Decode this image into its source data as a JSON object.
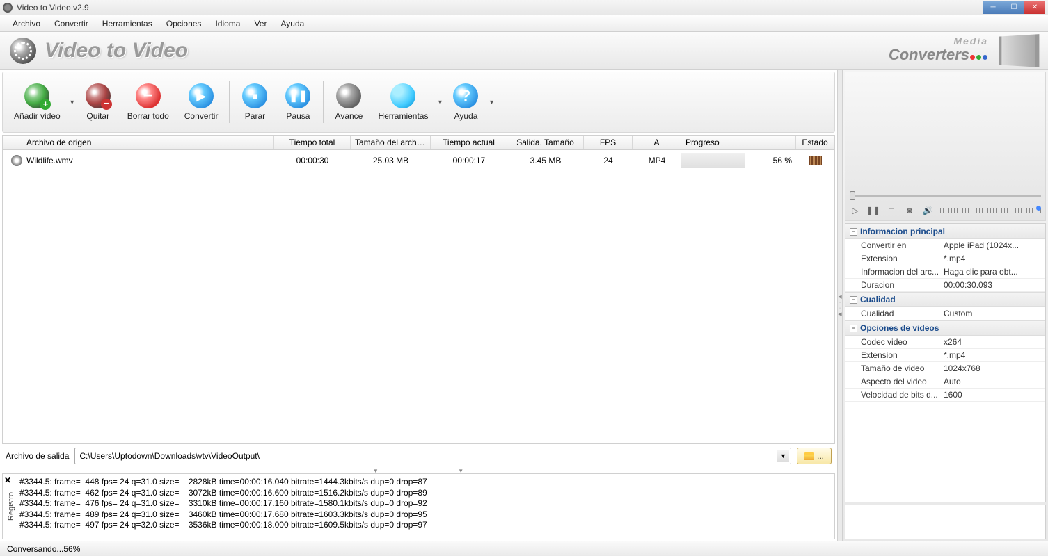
{
  "window": {
    "title": "Video to Video v2.9"
  },
  "menu": {
    "items": [
      "Archivo",
      "Convertir",
      "Herramientas",
      "Opciones",
      "Idioma",
      "Ver",
      "Ayuda"
    ]
  },
  "brand": {
    "text": "Video to Video",
    "right_logo": "Converters",
    "right_logo_sub": "Media"
  },
  "toolbar": {
    "add": "Añadir video",
    "remove": "Quitar",
    "clear": "Borrar todo",
    "convert": "Convertir",
    "stop": "Parar",
    "pause": "Pausa",
    "preview": "Avance",
    "tools": "Herramientas",
    "help": "Ayuda"
  },
  "grid": {
    "headers": {
      "file": "Archivo de origen",
      "total_time": "Tiempo total",
      "file_size": "Tamaño del archivo",
      "current_time": "Tiempo actual",
      "out_size": "Salida. Tamaño",
      "fps": "FPS",
      "a": "A",
      "progress": "Progreso",
      "state": "Estado"
    },
    "rows": [
      {
        "file": "Wildlife.wmv",
        "total_time": "00:00:30",
        "file_size": "25.03 MB",
        "current_time": "00:00:17",
        "out_size": "3.45 MB",
        "fps": "24",
        "a": "MP4",
        "progress_text": "56 %",
        "progress_pct": 56
      }
    ]
  },
  "output": {
    "label": "Archivo de salida",
    "path": "C:\\Users\\Uptodown\\Downloads\\vtv\\VideoOutput\\",
    "browse": "..."
  },
  "log": {
    "tab": "Registro",
    "lines": [
      "#3344.5: frame=  448 fps= 24 q=31.0 size=    2828kB time=00:00:16.040 bitrate=1444.3kbits/s dup=0 drop=87",
      "#3344.5: frame=  462 fps= 24 q=31.0 size=    3072kB time=00:00:16.600 bitrate=1516.2kbits/s dup=0 drop=89",
      "#3344.5: frame=  476 fps= 24 q=31.0 size=    3310kB time=00:00:17.160 bitrate=1580.1kbits/s dup=0 drop=92",
      "#3344.5: frame=  489 fps= 24 q=31.0 size=    3460kB time=00:00:17.680 bitrate=1603.3kbits/s dup=0 drop=95",
      "#3344.5: frame=  497 fps= 24 q=32.0 size=    3536kB time=00:00:18.000 bitrate=1609.5kbits/s dup=0 drop=97"
    ]
  },
  "status": {
    "text": "Conversando...56%"
  },
  "props": {
    "groups": [
      {
        "title": "Informacion principal",
        "rows": [
          {
            "k": "Convertir en",
            "v": "Apple iPad (1024x..."
          },
          {
            "k": "Extension",
            "v": "*.mp4"
          },
          {
            "k": "Informacion del arc...",
            "v": "Haga clic para obt..."
          },
          {
            "k": "Duracion",
            "v": "00:00:30.093"
          }
        ]
      },
      {
        "title": "Cualidad",
        "rows": [
          {
            "k": "Cualidad",
            "v": "Custom"
          }
        ]
      },
      {
        "title": "Opciones de videos",
        "rows": [
          {
            "k": "Codec video",
            "v": "x264"
          },
          {
            "k": "Extension",
            "v": "*.mp4"
          },
          {
            "k": "Tamaño de video",
            "v": "1024x768"
          },
          {
            "k": "Aspecto del video",
            "v": "Auto"
          },
          {
            "k": "Velocidad de bits d...",
            "v": "1600"
          }
        ]
      }
    ]
  }
}
